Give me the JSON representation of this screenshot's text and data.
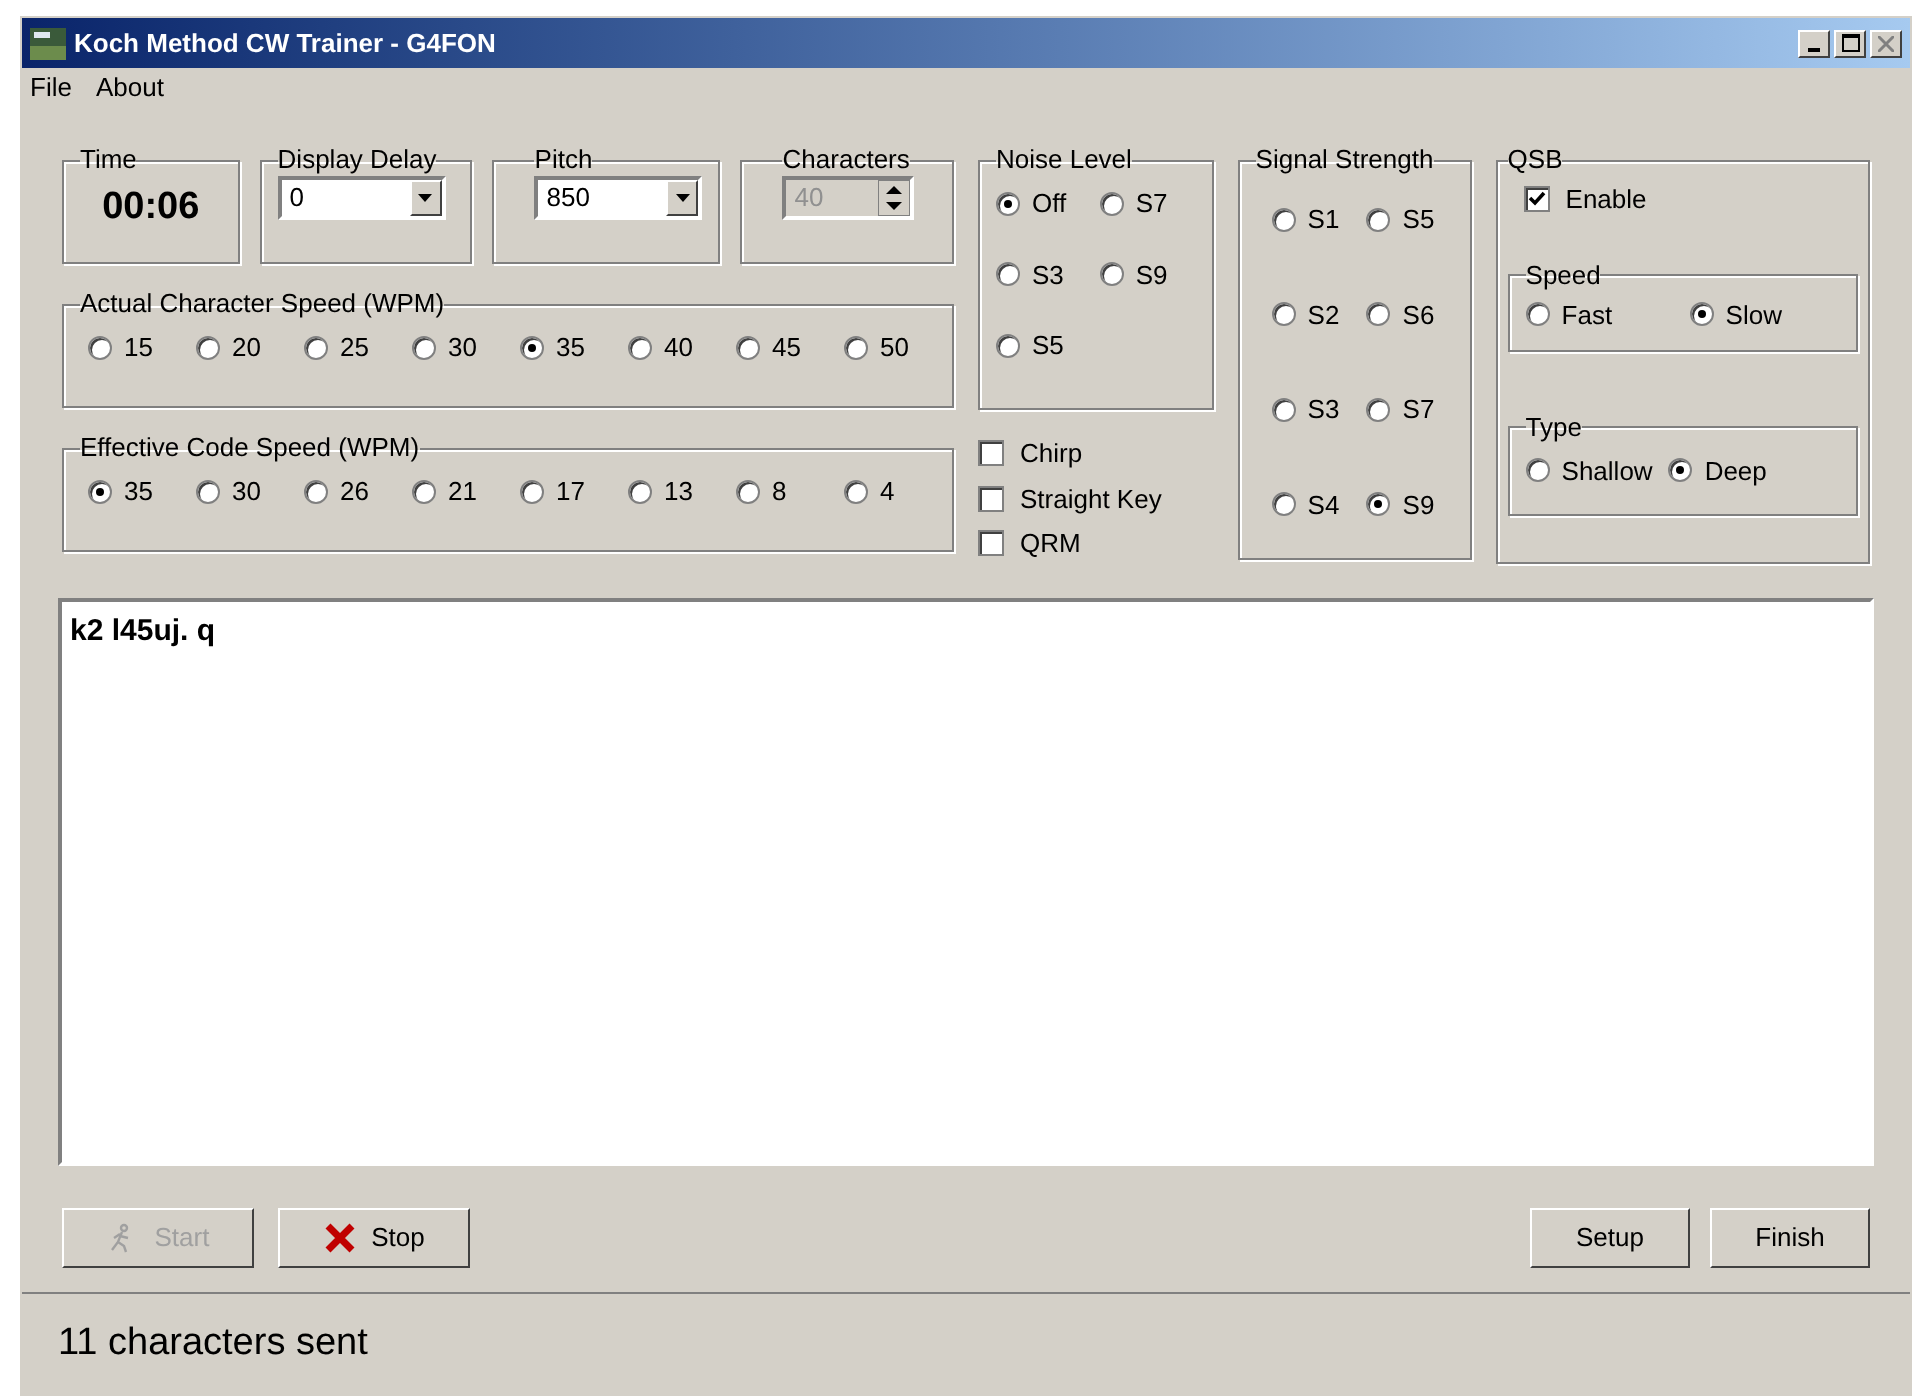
{
  "window": {
    "title": "Koch Method CW Trainer - G4FON"
  },
  "menu": [
    "File",
    "About"
  ],
  "time": {
    "label": "Time",
    "value": "00:06"
  },
  "display_delay": {
    "label": "Display Delay",
    "value": "0"
  },
  "pitch": {
    "label": "Pitch",
    "value": "850"
  },
  "characters": {
    "label": "Characters",
    "value": "40",
    "disabled": true
  },
  "actual_speed": {
    "label": "Actual Character Speed (WPM)",
    "options": [
      {
        "label": "15",
        "selected": false
      },
      {
        "label": "20",
        "selected": false
      },
      {
        "label": "25",
        "selected": false
      },
      {
        "label": "30",
        "selected": false
      },
      {
        "label": "35",
        "selected": true
      },
      {
        "label": "40",
        "selected": false
      },
      {
        "label": "45",
        "selected": false
      },
      {
        "label": "50",
        "selected": false
      }
    ]
  },
  "effective_speed": {
    "label": "Effective Code Speed (WPM)",
    "options": [
      {
        "label": "35",
        "selected": true
      },
      {
        "label": "30",
        "selected": false
      },
      {
        "label": "26",
        "selected": false
      },
      {
        "label": "21",
        "selected": false
      },
      {
        "label": "17",
        "selected": false
      },
      {
        "label": "13",
        "selected": false
      },
      {
        "label": "8",
        "selected": false
      },
      {
        "label": "4",
        "selected": false
      }
    ]
  },
  "noise_level": {
    "label": "Noise Level",
    "options": [
      {
        "label": "Off",
        "selected": true
      },
      {
        "label": "S7",
        "selected": false
      },
      {
        "label": "S3",
        "selected": false
      },
      {
        "label": "S9",
        "selected": false
      },
      {
        "label": "S5",
        "selected": false
      }
    ]
  },
  "checkboxes": [
    {
      "label": "Chirp",
      "checked": false
    },
    {
      "label": "Straight Key",
      "checked": false
    },
    {
      "label": "QRM",
      "checked": false
    }
  ],
  "signal_strength": {
    "label": "Signal Strength",
    "options": [
      {
        "label": "S1",
        "selected": false
      },
      {
        "label": "S5",
        "selected": false
      },
      {
        "label": "S2",
        "selected": false
      },
      {
        "label": "S6",
        "selected": false
      },
      {
        "label": "S3",
        "selected": false
      },
      {
        "label": "S7",
        "selected": false
      },
      {
        "label": "S4",
        "selected": false
      },
      {
        "label": "S9",
        "selected": true
      }
    ]
  },
  "qsb": {
    "label": "QSB",
    "enable": {
      "label": "Enable",
      "checked": true
    },
    "speed": {
      "label": "Speed",
      "options": [
        {
          "label": "Fast",
          "selected": false
        },
        {
          "label": "Slow",
          "selected": true
        }
      ]
    },
    "type": {
      "label": "Type",
      "options": [
        {
          "label": "Shallow",
          "selected": false
        },
        {
          "label": "Deep",
          "selected": true
        }
      ]
    }
  },
  "text_area": {
    "value": "k2 l45uj. q"
  },
  "buttons_left": [
    {
      "label": "Start",
      "kind": "start",
      "disabled": true
    },
    {
      "label": "Stop",
      "kind": "stop",
      "disabled": false
    }
  ],
  "buttons_right": [
    {
      "label": "Setup",
      "kind": "plain",
      "disabled": false
    },
    {
      "label": "Finish",
      "kind": "plain",
      "disabled": false
    }
  ],
  "status_bar": "11 characters sent"
}
